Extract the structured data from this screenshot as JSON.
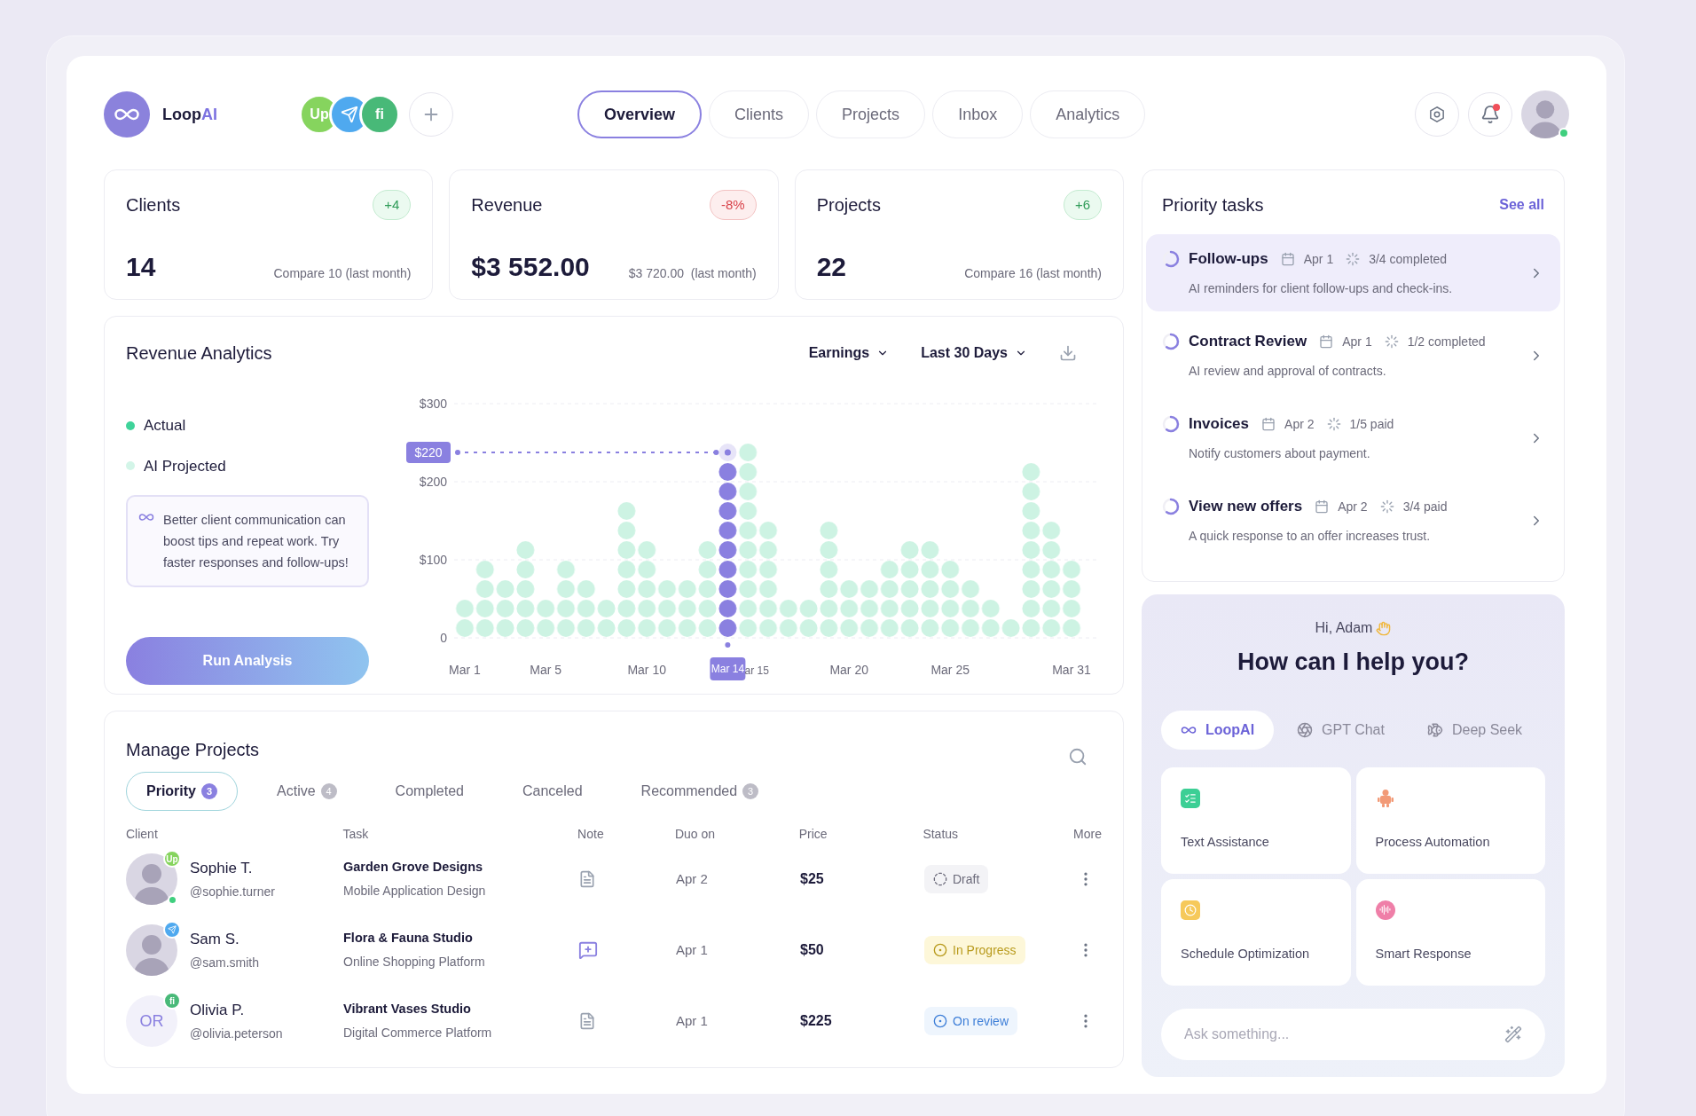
{
  "header": {
    "brand": {
      "name": "Loop",
      "accent": "AI"
    },
    "integrations": [
      {
        "kind": "text",
        "label": "Up",
        "color": "#86d45e"
      },
      {
        "kind": "plane",
        "color": "#4fa9ef"
      },
      {
        "kind": "text",
        "label": "fi",
        "color": "#48b978"
      }
    ],
    "nav": [
      {
        "label": "Overview",
        "selected": true
      },
      {
        "label": "Clients",
        "selected": false
      },
      {
        "label": "Projects",
        "selected": false
      },
      {
        "label": "Inbox",
        "selected": false
      },
      {
        "label": "Analytics",
        "selected": false
      }
    ],
    "notifications": {
      "unread": true
    },
    "user": {
      "online": true
    }
  },
  "stats": [
    {
      "title": "Clients",
      "badge": "+4",
      "negative": false,
      "value": "14",
      "compare": "Compare 10 (last month)"
    },
    {
      "title": "Revenue",
      "badge": "-8%",
      "negative": true,
      "value": "$3 552.00",
      "compare": "$3 720.00  (last month)"
    },
    {
      "title": "Projects",
      "badge": "+6",
      "negative": false,
      "value": "22",
      "compare": "Compare 16 (last month)"
    }
  ],
  "revenue_analytics": {
    "title": "Revenue Analytics",
    "filters": [
      "Earnings",
      "Last 30 Days"
    ],
    "legend": [
      {
        "label": "Actual",
        "color": "#3fd39a"
      },
      {
        "label": "AI Projected",
        "color": "#d3f5e8"
      }
    ],
    "tip": "Better client communication can boost tips and repeat work. Try faster responses and follow-ups!",
    "button": "Run Analysis",
    "chart_data": {
      "type": "bar",
      "categories": [
        "Mar 1",
        null,
        null,
        null,
        "Mar 5",
        null,
        null,
        null,
        null,
        "Mar 10",
        null,
        null,
        null,
        "Mar 14",
        "ar 15",
        null,
        null,
        null,
        null,
        "Mar 20",
        null,
        null,
        null,
        null,
        "Mar 25",
        null,
        null,
        null,
        null,
        null,
        "Mar 31"
      ],
      "stacked": true,
      "series": [
        {
          "color": "#cdf3e3",
          "values": [
            50,
            100,
            75,
            125,
            50,
            100,
            75,
            50,
            175,
            125,
            75,
            75,
            125,
            null,
            250,
            150,
            50,
            50,
            150,
            75,
            75,
            100,
            125,
            125,
            100,
            75,
            50,
            25,
            225,
            150,
            100
          ]
        },
        {
          "color": "#8a80e0",
          "values": [
            null,
            null,
            null,
            null,
            null,
            null,
            null,
            null,
            null,
            null,
            null,
            null,
            null,
            225,
            null,
            null,
            null,
            null,
            null,
            null,
            null,
            null,
            null,
            null,
            null,
            null,
            null,
            null,
            null,
            null,
            null
          ]
        }
      ],
      "ylim": [
        0,
        300
      ],
      "yticks": [
        {
          "value": 0,
          "label": "0"
        },
        {
          "value": 100,
          "label": "$100"
        },
        {
          "value": 200,
          "label": "$200"
        },
        {
          "value": 300,
          "label": "$300"
        }
      ],
      "annotations": [
        "$220"
      ]
    }
  },
  "manage_projects": {
    "title": "Manage Projects",
    "tabs": [
      {
        "label": "Priority",
        "count": "3",
        "selected": true
      },
      {
        "label": "Active",
        "count": "4",
        "selected": false
      },
      {
        "label": "Completed",
        "selected": false
      },
      {
        "label": "Canceled",
        "selected": false
      },
      {
        "label": "Recommended",
        "count": "3",
        "selected": false
      }
    ],
    "columns": [
      "Client",
      "Task",
      "Note",
      "Duo on",
      "Price",
      "Status",
      "More"
    ],
    "rows": [
      {
        "name": "Sophie T.",
        "handle": "@sophie.turner",
        "avatar": {
          "kind": "photo"
        },
        "badge": {
          "kind": "text",
          "label": "Up",
          "color": "#86d45e"
        },
        "online": true,
        "task": "Garden Grove Designs",
        "subtask": "Mobile Application Design",
        "note": {
          "kind": "plain"
        },
        "due": "Apr 2",
        "price": "$25",
        "status": {
          "kind": "draft",
          "label": "Draft"
        }
      },
      {
        "name": "Sam S.",
        "handle": "@sam.smith",
        "avatar": {
          "kind": "photo"
        },
        "badge": {
          "kind": "plane",
          "color": "#4fa9ef"
        },
        "online": false,
        "task": "Flora & Fauna Studio",
        "subtask": "Online Shopping Platform",
        "note": {
          "kind": "add"
        },
        "due": "Apr 1",
        "price": "$50",
        "status": {
          "kind": "progress",
          "label": "In Progress"
        }
      },
      {
        "name": "Olivia P.",
        "handle": "@olivia.peterson",
        "avatar": {
          "kind": "initials",
          "initials": "OR"
        },
        "badge": {
          "kind": "text",
          "label": "fi",
          "color": "#48b978"
        },
        "online": false,
        "task": "Vibrant Vases Studio",
        "subtask": "Digital Commerce Platform",
        "note": {
          "kind": "plain"
        },
        "due": "Apr 1",
        "price": "$225",
        "status": {
          "kind": "review",
          "label": "On review"
        }
      }
    ]
  },
  "priority_tasks": {
    "title": "Priority tasks",
    "link": "See all",
    "items": [
      {
        "title": "Follow-ups",
        "date": "Apr 1",
        "progress": "3/4 completed",
        "description": "AI reminders for client follow-ups and check-ins.",
        "selected": true
      },
      {
        "title": "Contract Review",
        "date": "Apr 1",
        "progress": "1/2 completed",
        "description": "AI review and approval of contracts.",
        "selected": false
      },
      {
        "title": "Invoices",
        "date": "Apr 2",
        "progress": "1/5 paid",
        "description": "Notify customers about payment.",
        "selected": false
      },
      {
        "title": "View new offers",
        "date": "Apr 2",
        "progress": "3/4 paid",
        "description": "A quick response to an offer increases trust.",
        "selected": false
      }
    ]
  },
  "assistant": {
    "greeting": "Hi, Adam",
    "heading": "How can I help you?",
    "models": [
      {
        "label": "LoopAI",
        "kind": "loop",
        "selected": true
      },
      {
        "label": "GPT Chat",
        "kind": "gpt",
        "selected": false
      },
      {
        "label": "Deep Seek",
        "kind": "whale",
        "selected": false
      }
    ],
    "features": [
      {
        "label": "Text Assistance",
        "kind": "checklist",
        "color": "#3ccf95"
      },
      {
        "label": "Process Automation",
        "kind": "robot",
        "color": "#f29a77"
      },
      {
        "label": "Schedule Optimization",
        "kind": "clock",
        "color": "#f6c95b"
      },
      {
        "label": "Smart Response",
        "kind": "voice",
        "color": "#ef7fa8"
      }
    ],
    "input": {
      "placeholder": "Ask something..."
    }
  }
}
